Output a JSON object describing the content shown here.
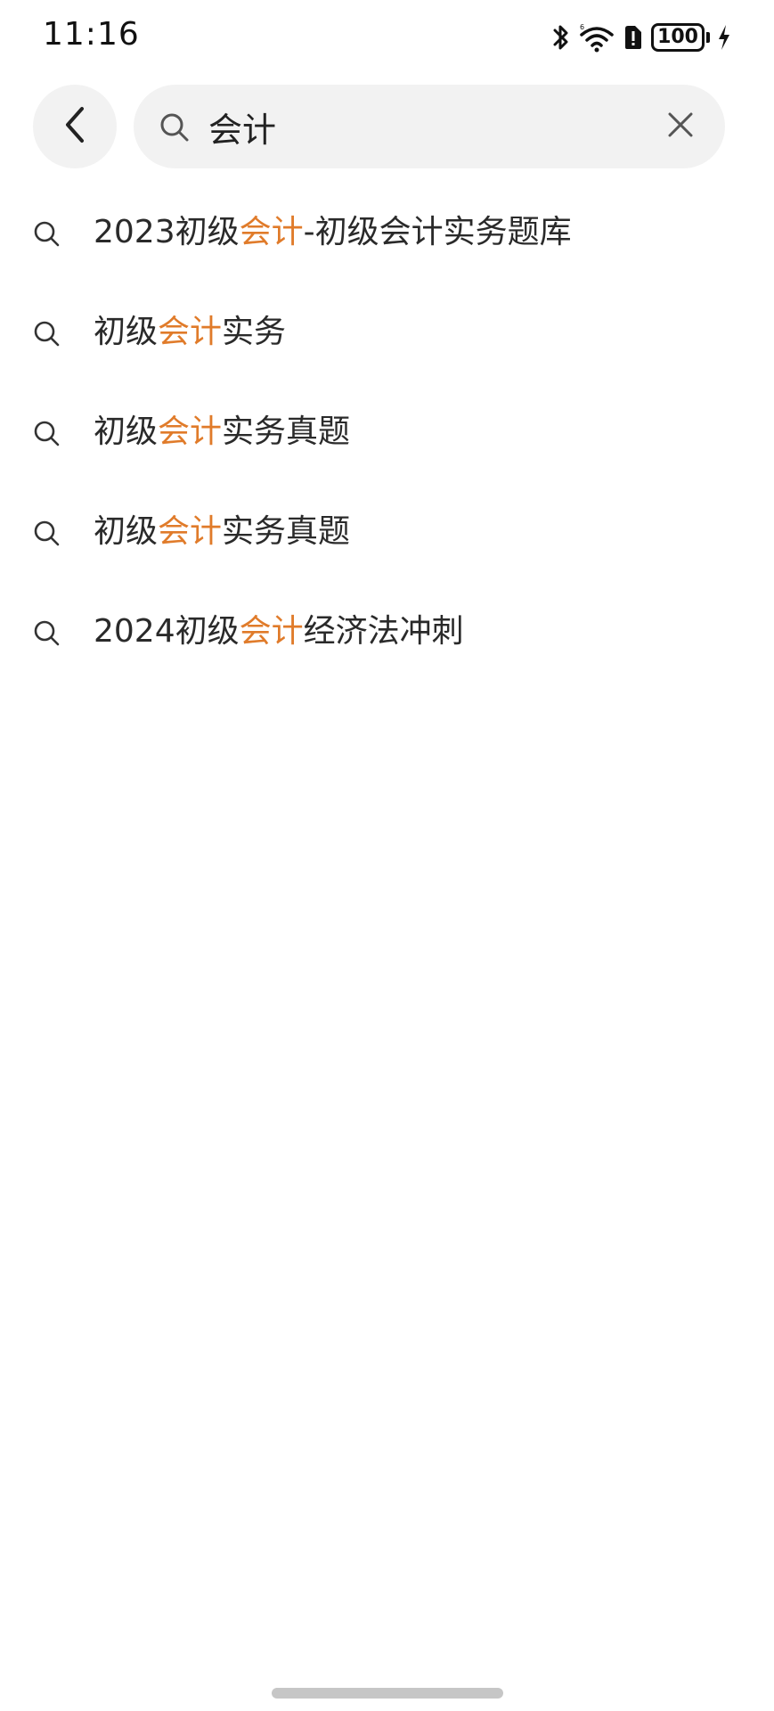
{
  "status_bar": {
    "time": "11:16",
    "battery": "100",
    "icons": [
      "bluetooth-icon",
      "wifi-icon",
      "alert-icon",
      "battery-icon",
      "charging-icon"
    ]
  },
  "search": {
    "query": "会计",
    "icons": {
      "back": "chevron-left-icon",
      "search": "search-icon",
      "clear": "close-icon"
    }
  },
  "suggestions": [
    {
      "before": "2023初级",
      "highlight": "会计",
      "after": "-初级会计实务题库"
    },
    {
      "before": "初级",
      "highlight": "会计",
      "after": "实务"
    },
    {
      "before": "初级",
      "highlight": "会计",
      "after": "实务真题"
    },
    {
      "before": "初级",
      "highlight": "会计",
      "after": "实务真题"
    },
    {
      "before": "2024初级",
      "highlight": "会计",
      "after": "经济法冲刺"
    }
  ],
  "colors": {
    "highlight": "#e07b2a",
    "text": "#2a2a2a",
    "pill_background": "#f2f2f2"
  }
}
